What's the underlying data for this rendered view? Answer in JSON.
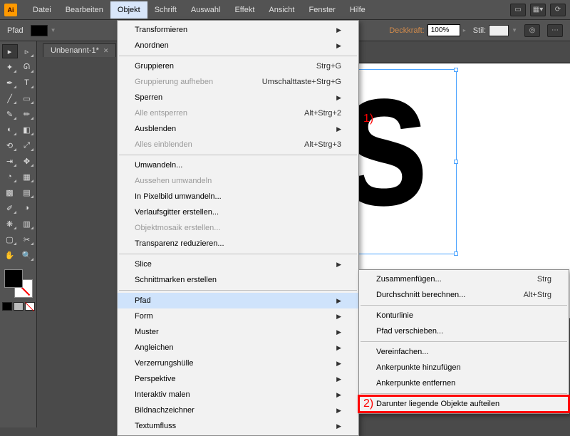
{
  "app": {
    "logo": "Ai"
  },
  "menubar": [
    "Datei",
    "Bearbeiten",
    "Objekt",
    "Schrift",
    "Auswahl",
    "Effekt",
    "Ansicht",
    "Fenster",
    "Hilfe"
  ],
  "menubar_open_index": 2,
  "controlbar": {
    "tool_label": "Pfad",
    "opacity_label": "Deckkraft:",
    "opacity_value": "100%",
    "style_label": "Stil:"
  },
  "doctab": {
    "name": "Unbenannt-1*"
  },
  "objekt_menu": [
    {
      "label": "Transformieren",
      "sub": true
    },
    {
      "label": "Anordnen",
      "sub": true
    },
    {
      "sep": true
    },
    {
      "label": "Gruppieren",
      "shortcut": "Strg+G"
    },
    {
      "label": "Gruppierung aufheben",
      "shortcut": "Umschalttaste+Strg+G",
      "disabled": true
    },
    {
      "label": "Sperren",
      "sub": true
    },
    {
      "label": "Alle entsperren",
      "shortcut": "Alt+Strg+2",
      "disabled": true
    },
    {
      "label": "Ausblenden",
      "sub": true
    },
    {
      "label": "Alles einblenden",
      "shortcut": "Alt+Strg+3",
      "disabled": true
    },
    {
      "sep": true
    },
    {
      "label": "Umwandeln..."
    },
    {
      "label": "Aussehen umwandeln",
      "disabled": true
    },
    {
      "label": "In Pixelbild umwandeln..."
    },
    {
      "label": "Verlaufsgitter erstellen..."
    },
    {
      "label": "Objektmosaik erstellen...",
      "disabled": true
    },
    {
      "label": "Transparenz reduzieren..."
    },
    {
      "sep": true
    },
    {
      "label": "Slice",
      "sub": true
    },
    {
      "label": "Schnittmarken erstellen"
    },
    {
      "sep": true
    },
    {
      "label": "Pfad",
      "sub": true,
      "hover": true
    },
    {
      "label": "Form",
      "sub": true
    },
    {
      "label": "Muster",
      "sub": true
    },
    {
      "label": "Angleichen",
      "sub": true
    },
    {
      "label": "Verzerrungshülle",
      "sub": true
    },
    {
      "label": "Perspektive",
      "sub": true
    },
    {
      "label": "Interaktiv malen",
      "sub": true
    },
    {
      "label": "Bildnachzeichner",
      "sub": true
    },
    {
      "label": "Textumfluss",
      "sub": true
    }
  ],
  "pfad_submenu": [
    {
      "label": "Zusammenfügen...",
      "shortcut": "Strg"
    },
    {
      "label": "Durchschnitt berechnen...",
      "shortcut": "Alt+Strg"
    },
    {
      "sep": true
    },
    {
      "label": "Konturlinie"
    },
    {
      "label": "Pfad verschieben..."
    },
    {
      "sep": true
    },
    {
      "label": "Vereinfachen..."
    },
    {
      "label": "Ankerpunkte hinzufügen"
    },
    {
      "label": "Ankerpunkte entfernen"
    },
    {
      "sep": true
    },
    {
      "label": "Darunter liegende Objekte aufteilen",
      "redbox": true
    }
  ],
  "annotations": {
    "one": "1)",
    "two": "2)"
  },
  "canvas_text": "las"
}
